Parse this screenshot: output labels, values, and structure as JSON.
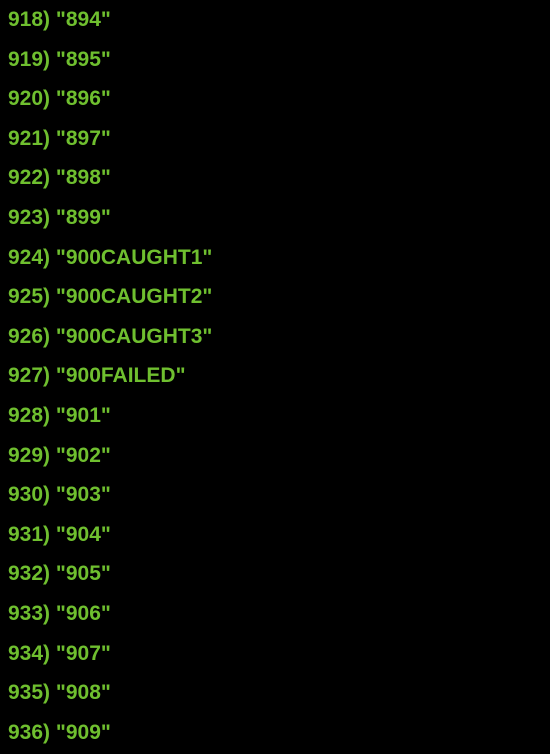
{
  "lines": [
    {
      "index": "918",
      "value": "894"
    },
    {
      "index": "919",
      "value": "895"
    },
    {
      "index": "920",
      "value": "896"
    },
    {
      "index": "921",
      "value": "897"
    },
    {
      "index": "922",
      "value": "898"
    },
    {
      "index": "923",
      "value": "899"
    },
    {
      "index": "924",
      "value": "900CAUGHT1"
    },
    {
      "index": "925",
      "value": "900CAUGHT2"
    },
    {
      "index": "926",
      "value": "900CAUGHT3"
    },
    {
      "index": "927",
      "value": "900FAILED"
    },
    {
      "index": "928",
      "value": "901"
    },
    {
      "index": "929",
      "value": "902"
    },
    {
      "index": "930",
      "value": "903"
    },
    {
      "index": "931",
      "value": "904"
    },
    {
      "index": "932",
      "value": "905"
    },
    {
      "index": "933",
      "value": "906"
    },
    {
      "index": "934",
      "value": "907"
    },
    {
      "index": "935",
      "value": "908"
    },
    {
      "index": "936",
      "value": "909"
    }
  ]
}
